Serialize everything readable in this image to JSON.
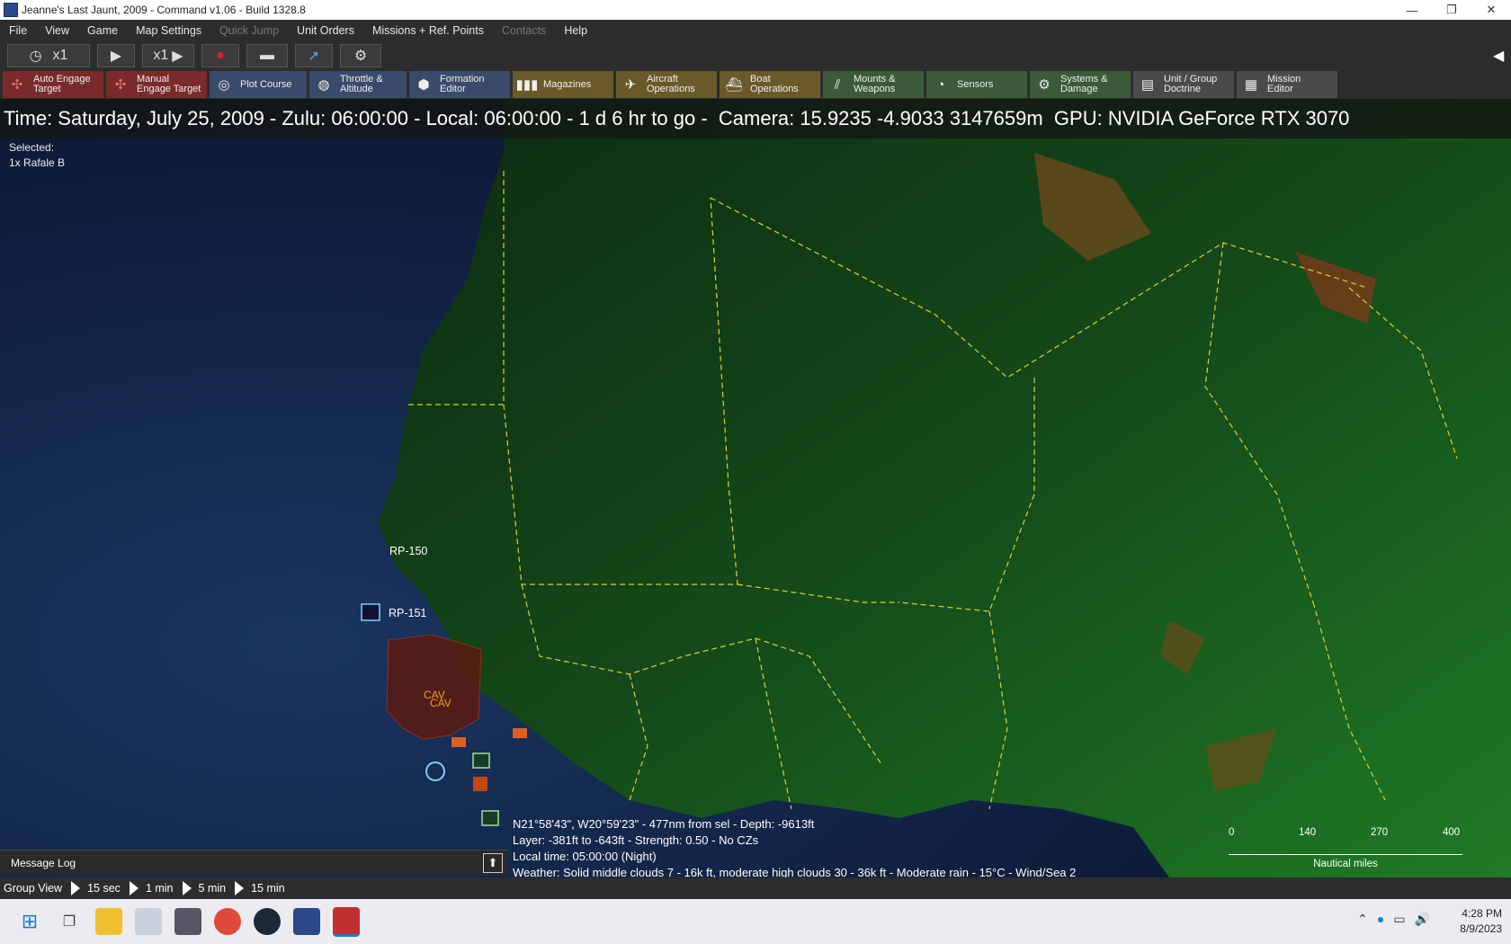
{
  "window": {
    "title": "Jeanne's Last Jaunt, 2009 - Command v1.06 - Build 1328.8"
  },
  "menu": {
    "items": [
      {
        "label": "File"
      },
      {
        "label": "View"
      },
      {
        "label": "Game"
      },
      {
        "label": "Map Settings"
      },
      {
        "label": "Quick Jump"
      },
      {
        "label": "Unit Orders"
      },
      {
        "label": "Missions + Ref. Points"
      },
      {
        "label": "Contacts"
      },
      {
        "label": "Help"
      }
    ]
  },
  "timecontrols": {
    "compression_1": "x1",
    "compression_2": "x1"
  },
  "toolbar": {
    "tools": [
      {
        "label": "Auto Engage\nTarget",
        "icon": "crosshair-icon",
        "color": "red"
      },
      {
        "label": "Manual\nEngage Target",
        "icon": "crosshair-icon",
        "color": "red"
      },
      {
        "label": "Plot Course",
        "icon": "compass-icon",
        "color": "blue"
      },
      {
        "label": "Throttle &\nAltitude",
        "icon": "gauge-icon",
        "color": "blue"
      },
      {
        "label": "Formation\nEditor",
        "icon": "hex-formation-icon",
        "color": "blue"
      },
      {
        "label": "Magazines",
        "icon": "ammo-icon",
        "color": "gold"
      },
      {
        "label": "Aircraft\nOperations",
        "icon": "aircraft-icon",
        "color": "gold"
      },
      {
        "label": "Boat\nOperations",
        "icon": "boat-icon",
        "color": "gold"
      },
      {
        "label": "Mounts &\nWeapons",
        "icon": "weapons-icon",
        "color": "green"
      },
      {
        "label": "Sensors",
        "icon": "radar-icon",
        "color": "green"
      },
      {
        "label": "Systems &\nDamage",
        "icon": "gear-icon",
        "color": "green"
      },
      {
        "label": "Unit / Group\nDoctrine",
        "icon": "document-icon",
        "color": "gray"
      },
      {
        "label": "Mission\nEditor",
        "icon": "editor-icon",
        "color": "gray"
      }
    ]
  },
  "status": {
    "line": "Time: Saturday, July 25, 2009 - Zulu: 06:00:00 - Local: 06:00:00 - 1 d 6 hr to go -  Camera: 15.9235 -4.9033 3147659m  GPU: NVIDIA GeForce RTX 3070"
  },
  "selection": {
    "heading": "Selected:",
    "unit": "1x Rafale B"
  },
  "map": {
    "ref_points": [
      "RP-150",
      "RP-151"
    ],
    "unit_labels": [
      "CAV",
      "CAV"
    ]
  },
  "cursor_info": {
    "line1": "N21°58'43\", W20°59'23\" - 477nm from sel - Depth: -9613ft",
    "line2": "Layer: -381ft to -643ft - Strength: 0.50 - No CZs",
    "line3": "Local time: 05:00:00 (Night)",
    "line4": "Weather: Solid middle clouds 7 - 16k ft, moderate high clouds 30 - 36k ft - Moderate rain - 15°C - Wind/Sea 2"
  },
  "scale": {
    "ticks": [
      "0",
      "140",
      "270",
      "400"
    ],
    "unit": "Nautical miles"
  },
  "message_log": {
    "label": "Message Log"
  },
  "group_view": {
    "label": "Group View",
    "options": [
      "15 sec",
      "1 min",
      "5 min",
      "15 min"
    ]
  },
  "taskbar": {
    "time": "4:28 PM",
    "date": "8/9/2023"
  }
}
